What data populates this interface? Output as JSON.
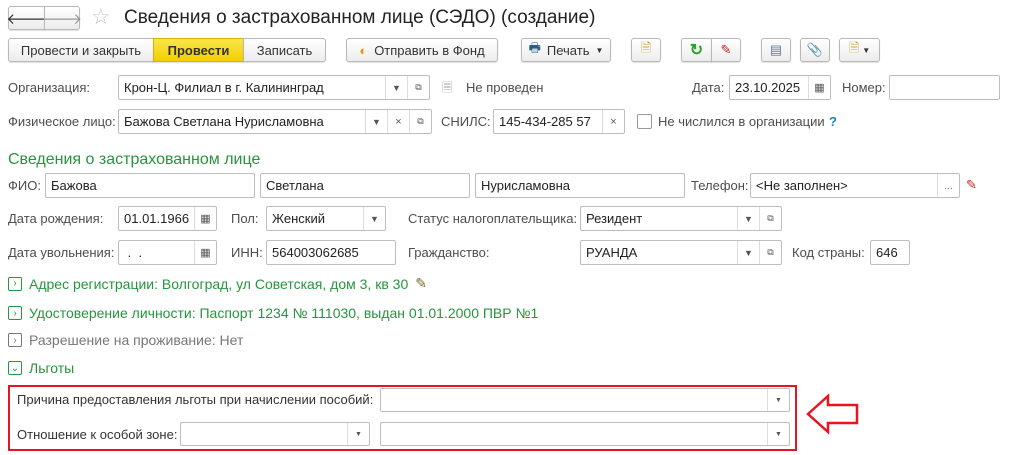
{
  "title": "Сведения о застрахованном лице (СЭДО) (создание)",
  "toolbar": {
    "post_close": "Провести и закрыть",
    "post": "Провести",
    "save": "Записать",
    "send": "Отправить в Фонд",
    "print": "Печать"
  },
  "header": {
    "org_label": "Организация:",
    "org_value": "Крон-Ц. Филиал в г. Калининград",
    "status": "Не проведен",
    "date_label": "Дата:",
    "date_value": "23.10.2025",
    "number_label": "Номер:",
    "number_value": "",
    "person_label": "Физическое лицо:",
    "person_value": "Бажова Светлана Нурисламовна",
    "snils_label": "СНИЛС:",
    "snils_value": "145-434-285 57",
    "not_listed_label": "Не числился в организации",
    "help": "?"
  },
  "insured": {
    "section_title": "Сведения о застрахованном лице",
    "fio_label": "ФИО:",
    "last_name": "Бажова",
    "first_name": "Светлана",
    "middle_name": "Нурисламовна",
    "phone_label": "Телефон:",
    "phone_value": "<Не заполнен>",
    "birth_label": "Дата рождения:",
    "birth_value": "01.01.1966",
    "sex_label": "Пол:",
    "sex_value": "Женский",
    "tax_status_label": "Статус налогоплательщика:",
    "tax_status_value": "Резидент",
    "dismissal_label": "Дата увольнения:",
    "dismissal_value": " .  .",
    "inn_label": "ИНН:",
    "inn_value": "564003062685",
    "citizenship_label": "Гражданство:",
    "citizenship_value": "РУАНДА",
    "country_code_label": "Код страны:",
    "country_code_value": "646"
  },
  "sections": [
    {
      "label": "Адрес регистрации: Волгоград, ул Советская, дом 3, кв 30",
      "state": "collapsed"
    },
    {
      "label": "Удостоверение личности: Паспорт 1234 № 111030, выдан 01.01.2000 ПВР №1",
      "state": "collapsed"
    },
    {
      "label": "Разрешение на проживание: Нет",
      "state": "collapsed"
    },
    {
      "label": "Льготы",
      "state": "expanded"
    }
  ],
  "benefits": {
    "reason_label": "Причина предоставления льготы при начислении пособий:",
    "reason_value": "",
    "zone_label": "Отношение к особой зоне:",
    "zone_value1": "",
    "zone_value2": ""
  },
  "colors": {
    "accent_green": "#27943e",
    "highlight_red": "#e8141e",
    "post_yellow": "#f5d800"
  }
}
